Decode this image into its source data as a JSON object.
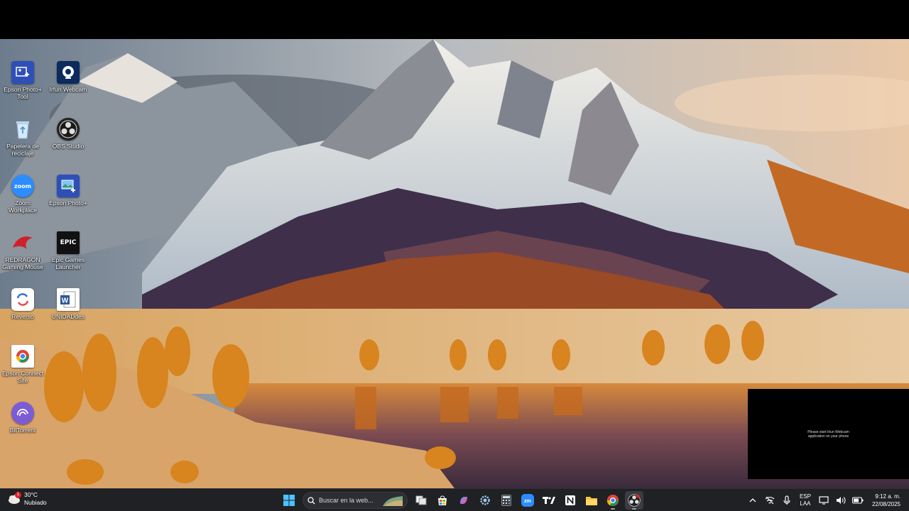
{
  "desktop": {
    "icons": [
      {
        "label": "Epson Photo+ Tool",
        "icon": "epson-photo-tool-icon",
        "color": "#2f4fb8"
      },
      {
        "label": "Irfun Webcam",
        "icon": "webcam-icon",
        "color": "#0d2a5c"
      },
      {
        "label": "Papelera de reciclaje",
        "icon": "recycle-bin-icon",
        "color": "#cfe3f5"
      },
      {
        "label": "OBS Studio",
        "icon": "obs-studio-icon",
        "color": "#222222"
      },
      {
        "label": "Zoom Workplace",
        "icon": "zoom-icon",
        "color": "#2d8cff"
      },
      {
        "label": "Epson Photo+",
        "icon": "epson-photo-icon",
        "color": "#2f4fb8"
      },
      {
        "label": "REDRAGON Gaming Mouse",
        "icon": "redragon-icon",
        "color": "#d1202a"
      },
      {
        "label": "Epic Games Launcher",
        "icon": "epic-games-icon",
        "color": "#111111"
      },
      {
        "label": "Reverso",
        "icon": "reverso-icon",
        "color": "#ffffff"
      },
      {
        "label": "UNIDADdes",
        "icon": "word-document-icon",
        "color": "#ffffff"
      },
      {
        "label": "Epson Connect Site",
        "icon": "chrome-shortcut-icon",
        "color": "#ffffff"
      },
      {
        "label": "BitTorrent",
        "icon": "bittorrent-icon",
        "color": "#7b5cd6"
      }
    ]
  },
  "webcam_preview": {
    "message": "Please start Iriun Webcam\napplication on your phone"
  },
  "taskbar": {
    "weather": {
      "temperature": "30°C",
      "condition": "Nubiado",
      "badge": "1"
    },
    "search": {
      "placeholder": "Buscar en la web..."
    },
    "apps": [
      {
        "name": "start-button",
        "icon": "windows-logo-icon"
      },
      {
        "name": "task-view-button",
        "icon": "task-view-icon"
      },
      {
        "name": "store-button",
        "icon": "microsoft-store-icon"
      },
      {
        "name": "copilot-button",
        "icon": "copilot-icon"
      },
      {
        "name": "settings-button",
        "icon": "gear-icon"
      },
      {
        "name": "calculator-button",
        "icon": "calculator-icon"
      },
      {
        "name": "zoom-button",
        "icon": "zoom-icon"
      },
      {
        "name": "tradingview-button",
        "icon": "tradingview-icon"
      },
      {
        "name": "notion-button",
        "icon": "notion-icon"
      },
      {
        "name": "file-explorer-button",
        "icon": "folder-icon"
      },
      {
        "name": "chrome-button",
        "icon": "chrome-icon"
      },
      {
        "name": "obs-button",
        "icon": "obs-studio-icon"
      }
    ],
    "tray": {
      "language": "ESP",
      "layout": "LAA",
      "time": "9:12 a. m.",
      "date": "22/08/2025"
    }
  }
}
